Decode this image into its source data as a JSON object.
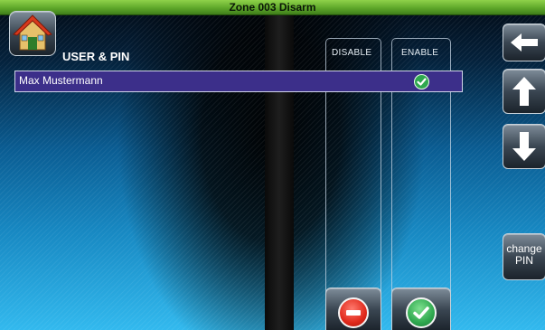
{
  "title": "Zone 003  Disarm",
  "heading": "USER & PIN",
  "columns": {
    "disable": "DISABLE",
    "enable": "ENABLE"
  },
  "rows": [
    {
      "name": "Max Mustermann",
      "enabled": true
    }
  ],
  "sidebar": {
    "back_icon": "arrow-left-icon",
    "up_icon": "arrow-up-icon",
    "down_icon": "arrow-down-icon",
    "change_pin": "change\nPIN"
  },
  "actions": {
    "disable_icon": "minus-circle-icon",
    "enable_icon": "check-circle-icon"
  },
  "colors": {
    "title_bar": "#5fa82a",
    "row_selected": "#3c2f8a",
    "enable_green": "#2fa84f",
    "disable_red": "#e0291b"
  }
}
